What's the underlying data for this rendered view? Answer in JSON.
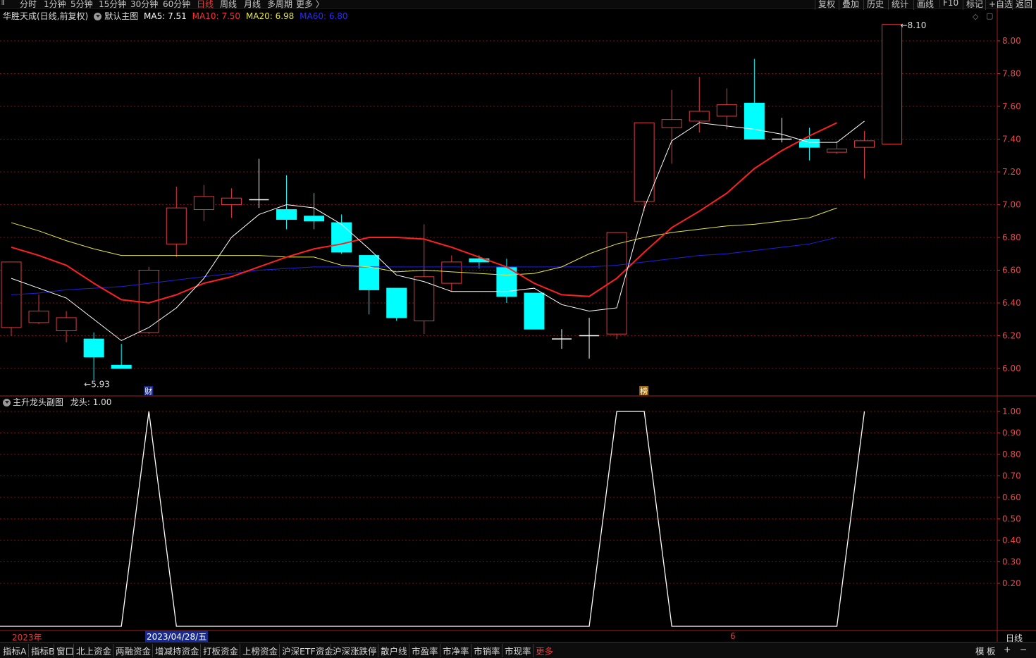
{
  "periods": [
    "分时",
    "1分钟",
    "5分钟",
    "15分钟",
    "30分钟",
    "60分钟",
    "日线",
    "周线",
    "月线",
    "多周期",
    "更多 〉"
  ],
  "active_period": "日线",
  "right_buttons": [
    "复权",
    "叠加",
    "历史",
    "统计",
    "画线",
    "F10",
    "标记",
    "+自选",
    "返回"
  ],
  "main_info": {
    "stock_label": "华胜天成(日线,前复权)",
    "template": "默认主图",
    "ma5": "MA5: 7.51",
    "ma10": "MA10: 7.50",
    "ma20": "MA20: 6.98",
    "ma60": "MA60: 6.80"
  },
  "colors": {
    "up": "#e23a3a",
    "down": "#00ffff",
    "ma5": "#ffffff",
    "ma10": "#ff2020",
    "ma20": "#e6e64a",
    "ma60": "#2020dd",
    "grid": "#7a1010"
  },
  "price_axis": [
    "8.00",
    "7.80",
    "7.60",
    "7.40",
    "7.20",
    "7.00",
    "6.80",
    "6.60",
    "6.40",
    "6.20",
    "6.00"
  ],
  "high_mark": "8.10",
  "low_mark": "5.93",
  "event_marks": {
    "fin": "财",
    "rank": "榜"
  },
  "chart_data": [
    {
      "type": "candlestick",
      "title": "华胜天成(日线,前复权)",
      "ylim": [
        5.85,
        8.22
      ],
      "candles": [
        {
          "o": 6.25,
          "c": 6.65,
          "h": 6.65,
          "l": 6.2
        },
        {
          "o": 6.28,
          "c": 6.35,
          "h": 6.45,
          "l": 6.27
        },
        {
          "o": 6.23,
          "c": 6.31,
          "h": 6.35,
          "l": 6.16
        },
        {
          "o": 6.18,
          "c": 6.07,
          "h": 6.22,
          "l": 5.93
        },
        {
          "o": 6.02,
          "c": 6.0,
          "h": 6.15,
          "l": 6.0
        },
        {
          "o": 6.22,
          "c": 6.6,
          "h": 6.62,
          "l": 6.21
        },
        {
          "o": 6.76,
          "c": 6.98,
          "h": 7.11,
          "l": 6.68
        },
        {
          "o": 6.97,
          "c": 7.05,
          "h": 7.12,
          "l": 6.9
        },
        {
          "o": 7.0,
          "c": 7.04,
          "h": 7.1,
          "l": 6.92
        },
        {
          "o": 7.03,
          "c": 7.03,
          "h": 7.28,
          "l": 6.98
        },
        {
          "o": 6.97,
          "c": 6.91,
          "h": 7.18,
          "l": 6.85
        },
        {
          "o": 6.93,
          "c": 6.9,
          "h": 7.07,
          "l": 6.85
        },
        {
          "o": 6.89,
          "c": 6.71,
          "h": 6.94,
          "l": 6.7
        },
        {
          "o": 6.69,
          "c": 6.48,
          "h": 6.69,
          "l": 6.33
        },
        {
          "o": 6.49,
          "c": 6.31,
          "h": 6.49,
          "l": 6.29
        },
        {
          "o": 6.29,
          "c": 6.56,
          "h": 6.88,
          "l": 6.21
        },
        {
          "o": 6.52,
          "c": 6.65,
          "h": 6.69,
          "l": 6.47
        },
        {
          "o": 6.67,
          "c": 6.65,
          "h": 6.69,
          "l": 6.61
        },
        {
          "o": 6.62,
          "c": 6.44,
          "h": 6.67,
          "l": 6.4
        },
        {
          "o": 6.46,
          "c": 6.24,
          "h": 6.46,
          "l": 6.24
        },
        {
          "o": 6.18,
          "c": 6.18,
          "h": 6.24,
          "l": 6.12
        },
        {
          "o": 6.2,
          "c": 6.2,
          "h": 6.31,
          "l": 6.06
        },
        {
          "o": 6.21,
          "c": 6.83,
          "h": 6.83,
          "l": 6.18
        },
        {
          "o": 7.02,
          "c": 7.5,
          "h": 7.5,
          "l": 6.96
        },
        {
          "o": 7.47,
          "c": 7.52,
          "h": 7.7,
          "l": 7.25
        },
        {
          "o": 7.51,
          "c": 7.57,
          "h": 7.78,
          "l": 7.44
        },
        {
          "o": 7.54,
          "c": 7.61,
          "h": 7.71,
          "l": 7.46
        },
        {
          "o": 7.62,
          "c": 7.4,
          "h": 7.89,
          "l": 7.4
        },
        {
          "o": 7.4,
          "c": 7.4,
          "h": 7.53,
          "l": 7.38
        },
        {
          "o": 7.4,
          "c": 7.35,
          "h": 7.47,
          "l": 7.27
        },
        {
          "o": 7.32,
          "c": 7.34,
          "h": 7.39,
          "l": 7.31
        },
        {
          "o": 7.35,
          "c": 7.39,
          "h": 7.45,
          "l": 7.16
        },
        {
          "o": 7.37,
          "c": 8.1,
          "h": 8.1,
          "l": 7.37
        }
      ],
      "ma5": [
        6.55,
        6.49,
        6.43,
        6.3,
        6.17,
        6.25,
        6.37,
        6.55,
        6.8,
        6.94,
        7.0,
        6.98,
        6.88,
        6.73,
        6.57,
        6.53,
        6.47,
        6.47,
        6.47,
        6.49,
        6.39,
        6.35,
        6.37,
        6.98,
        7.39,
        7.5,
        7.48,
        7.46,
        7.43,
        7.38,
        7.38,
        7.51
      ],
      "ma10": [
        6.74,
        6.69,
        6.63,
        6.52,
        6.42,
        6.4,
        6.45,
        6.52,
        6.56,
        6.62,
        6.68,
        6.73,
        6.76,
        6.8,
        6.8,
        6.79,
        6.74,
        6.68,
        6.62,
        6.52,
        6.45,
        6.44,
        6.55,
        6.71,
        6.86,
        6.96,
        7.07,
        7.22,
        7.33,
        7.42,
        7.5
      ],
      "ma20": [
        6.89,
        6.84,
        6.78,
        6.73,
        6.69,
        6.69,
        6.69,
        6.69,
        6.69,
        6.69,
        6.68,
        6.68,
        6.63,
        6.62,
        6.59,
        6.6,
        6.59,
        6.58,
        6.57,
        6.58,
        6.62,
        6.7,
        6.76,
        6.8,
        6.83,
        6.85,
        6.87,
        6.88,
        6.9,
        6.92,
        6.98
      ],
      "ma60": [
        6.45,
        6.46,
        6.48,
        6.49,
        6.5,
        6.52,
        6.54,
        6.56,
        6.58,
        6.6,
        6.61,
        6.62,
        6.62,
        6.62,
        6.62,
        6.62,
        6.62,
        6.62,
        6.62,
        6.62,
        6.62,
        6.62,
        6.63,
        6.65,
        6.67,
        6.69,
        6.7,
        6.72,
        6.74,
        6.76,
        6.8
      ]
    },
    {
      "type": "line",
      "title": "主升龙头副图",
      "series_name": "龙头",
      "ylim": [
        0,
        1.05
      ],
      "values": [
        0,
        0,
        0,
        0,
        0,
        1,
        0,
        0,
        0,
        0,
        0,
        0,
        0,
        0,
        0,
        0,
        0,
        0,
        0,
        0,
        0,
        0,
        1,
        1,
        0,
        0,
        0,
        0,
        0,
        0,
        0,
        1
      ]
    }
  ],
  "sub_info": {
    "label": "主升龙头副图",
    "value": "龙头: 1.00"
  },
  "sub_axis": [
    "1.00",
    "0.90",
    "0.80",
    "0.70",
    "0.60",
    "0.50",
    "0.40",
    "0.30",
    "0.20"
  ],
  "date_axis": {
    "year": "2023年",
    "cursor_date": "2023/04/28/五",
    "month": "6",
    "period": "日线"
  },
  "bottom_tabs": [
    "指标A",
    "指标B",
    "窗口",
    "北上资金",
    "两融资金",
    "增减持资金",
    "打板资金",
    "上榜资金",
    "沪深ETF资金",
    "沪深涨跌停",
    "散户线",
    "市盈率",
    "市净率",
    "市销率",
    "市现率",
    "更多"
  ],
  "bottom_right": [
    "模",
    "板",
    "+",
    "−"
  ]
}
